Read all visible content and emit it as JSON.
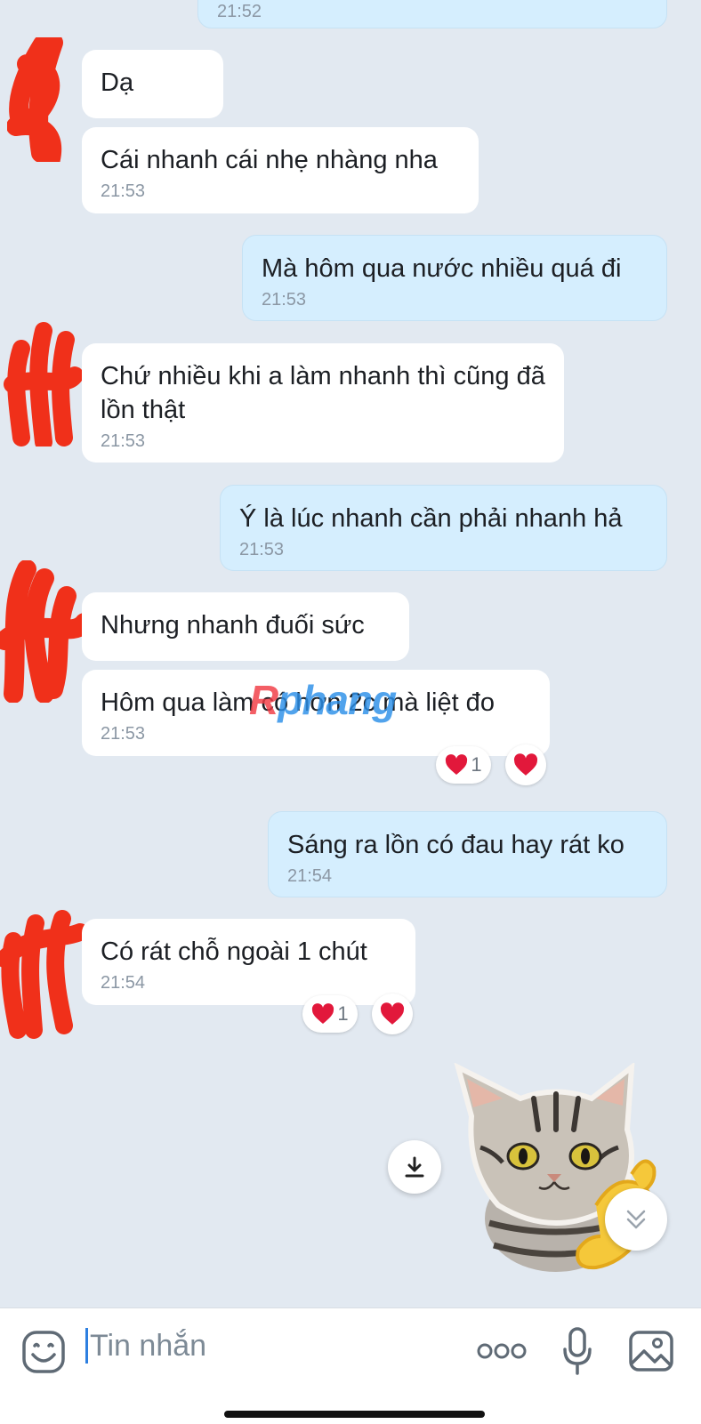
{
  "messages": [
    {
      "id": "m0",
      "direction": "out",
      "text": "",
      "time": "21:52"
    },
    {
      "id": "m1",
      "direction": "in",
      "text": "Dạ",
      "time": ""
    },
    {
      "id": "m2",
      "direction": "in",
      "text": "Cái nhanh cái nhẹ nhàng nha",
      "time": "21:53"
    },
    {
      "id": "m3",
      "direction": "out",
      "text": "Mà hôm qua nước nhiều quá đi",
      "time": "21:53"
    },
    {
      "id": "m4",
      "direction": "in",
      "text": "Chứ nhiều khi a làm nhanh thì cũng đã lồn thật",
      "time": "21:53"
    },
    {
      "id": "m5",
      "direction": "out",
      "text": "Ý là lúc nhanh cần phải nhanh hả",
      "time": "21:53"
    },
    {
      "id": "m6",
      "direction": "in",
      "text": "Nhưng nhanh đuối sức",
      "time": ""
    },
    {
      "id": "m7",
      "direction": "in",
      "text": "Hôm qua làm có hơn 2c mà liệt đo",
      "time": "21:53",
      "reaction_count": "1"
    },
    {
      "id": "m8",
      "direction": "out",
      "text": "Sáng ra lồn có đau hay rát ko",
      "time": "21:54"
    },
    {
      "id": "m9",
      "direction": "in",
      "text": "Có rát chỗ ngoài 1 chút",
      "time": "21:54",
      "reaction_count": "1"
    }
  ],
  "watermark": "Rphang",
  "composer": {
    "placeholder": "Tin nhắn"
  },
  "icons": {
    "emoji": "emoji-icon",
    "more": "more-dots-icon",
    "mic": "microphone-icon",
    "gallery": "image-gallery-icon",
    "download": "download-icon",
    "scroll_down": "double-chevron-down-icon",
    "heart": "heart-icon"
  },
  "colors": {
    "background": "#e2e9f1",
    "incoming_bubble": "#ffffff",
    "outgoing_bubble": "#d5eefe",
    "heart": "#e2183b",
    "cursor": "#2d7fe0"
  }
}
